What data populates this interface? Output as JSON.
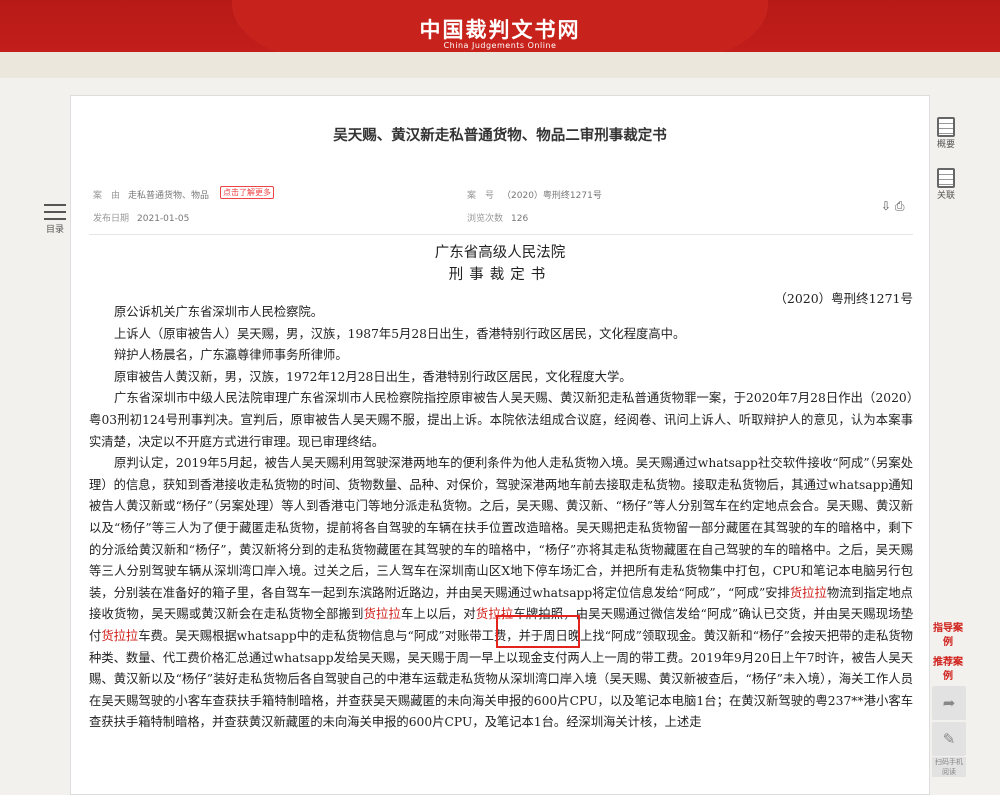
{
  "site": {
    "title": "中国裁判文书网",
    "subtitle": "China Judgements Online"
  },
  "document": {
    "title": "吴天赐、黄汉新走私普通货物、物品二审刑事裁定书",
    "meta": {
      "cause_label": "案　由",
      "cause_value": "走私普通货物、物品",
      "cause_tag": "点击了解更多",
      "case_no_label": "案　号",
      "case_no_value": "（2020）粤刑终1271号",
      "publish_label": "发布日期",
      "publish_value": "2021-01-05",
      "views_label": "浏览次数",
      "views_value": "126"
    },
    "court": "广东省高级人民法院",
    "doc_type": "刑事裁定书",
    "case_number": "（2020）粤刑终1271号",
    "paragraphs": [
      "原公诉机关广东省深圳市人民检察院。",
      "上诉人（原审被告人）吴天赐，男，汉族，1987年5月28日出生，香港特别行政区居民，文化程度高中。",
      "辩护人杨晨名，广东瀛尊律师事务所律师。",
      "原审被告人黄汉新，男，汉族，1972年12月28日出生，香港特别行政区居民，文化程度大学。",
      "广东省深圳市中级人民法院审理广东省深圳市人民检察院指控原审被告人吴天赐、黄汉新犯走私普通货物罪一案，于2020年7月28日作出（2020）粤03刑初124号刑事判决。宣判后，原审被告人吴天赐不服，提出上诉。本院依法组成合议庭，经阅卷、讯问上诉人、听取辩护人的意见，认为本案事实清楚，决定以不开庭方式进行审理。现已审理终结。"
    ],
    "para_main": [
      "原判认定，2019年5月起，被告人吴天赐利用驾驶深港两地车的便利条件为他人走私货物入境。吴天赐通过whatsapp社交软件接收“阿成”（另案处理）的信息，获知到香港接收走私货物的时间、货物数量、品种、对保价，驾驶深港两地车前去接取走私货物。接取走私货物后，其通过whatsapp通知被告人黄汉新或“杨仔”（另案处理）等人到香港屯门等地分派走私货物。之后，吴天赐、黄汉新、“杨仔”等人分别驾车在约定地点会合。吴天赐、黄汉新以及“杨仔”等三人为了便于藏匿走私货物，提前将各自驾驶的车辆在扶手位置改造暗格。吴天赐把走私货物留一部分藏匿在其驾驶的车的暗格中，剩下的分派给黄汉新和“杨仔”，黄汉新将分到的走私货物藏匿在其驾驶的车的暗格中，“杨仔”亦将其走私货物藏匿在自己驾驶的车的暗格中。之后，吴天赐等三人分别驾驶车辆从深圳湾口岸入境。过关之后，三人驾车在深圳南山区X地下停车场汇合，并把所有走私货物集中打包，CPU和笔记本电脑另行包装，分别装在准备好的箱子里，各自驾车一起到东滨路附近路边，并由吴天赐通过whatsapp将定位信息发给“阿成”，“阿成”安排",
      "货拉拉",
      "物流到指定地点接收货物，吴天赐或黄汉新会在走私货物全部搬到",
      "货拉拉",
      "车上以后，对",
      "货拉拉",
      "车牌拍照，由吴天赐通过微信发给“阿成”确认已交货，并由吴天赐现场垫付",
      "货拉拉",
      "车费。吴天赐根据whatsapp中的走私货物信息与“阿成”对账带工费，并于周日晚上找“阿成”领取现金。黄汉新和“杨仔”会按天把带的走私货物种类、数量、代工费价格汇总通过whatsapp发给吴天赐，吴天赐于周一早上以现金支付两人上一周的带工费。2019年9月20日上午7时许，被告人吴天赐、黄汉新以及“杨仔”装好走私货物后各自驾驶自己的中港车运载走私货物从深圳湾口岸入境（吴天赐、黄汉新被查后，“杨仔”未入境），海关工作人员在吴天赐驾驶的小客车查获扶手箱特制暗格，并查获吴天赐藏匿的未向海关申报的600片CPU，以及笔记本电脑1台；在黄汉新驾驶的粤237**港小客车查获扶手箱特制暗格，并查获黄汉新藏匿的未向海关申报的600片CPU，及笔记本1台。经深圳海关计核，上述走"
    ]
  },
  "toolbar": {
    "outline_label": "概要",
    "related_label": "关联",
    "toc_label": "目录",
    "guide_label": "指导案例",
    "typical_label": "推荐案例",
    "last_label": "扫码手机阅读"
  },
  "colors": {
    "brand": "#c8221c",
    "highlight": "#d0211c"
  }
}
